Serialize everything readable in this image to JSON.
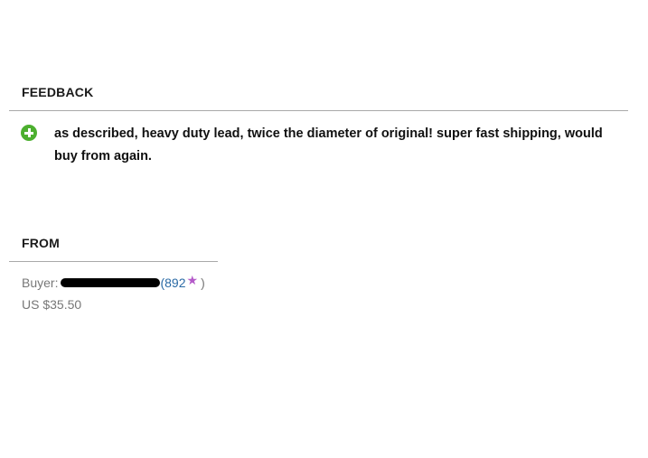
{
  "feedback": {
    "heading": "FEEDBACK",
    "icon": "positive-plus-icon",
    "icon_color": "#4caf2f",
    "comment": "as described, heavy duty lead, twice the diameter of original! super fast shipping, would buy from again."
  },
  "from": {
    "heading": "FROM",
    "buyer_label": "Buyer:",
    "buyer_name_redacted": true,
    "score_open": "(",
    "score": "892",
    "star": "★",
    "star_color": "#b45ac9",
    "score_close": ")",
    "price": "US $35.50"
  }
}
